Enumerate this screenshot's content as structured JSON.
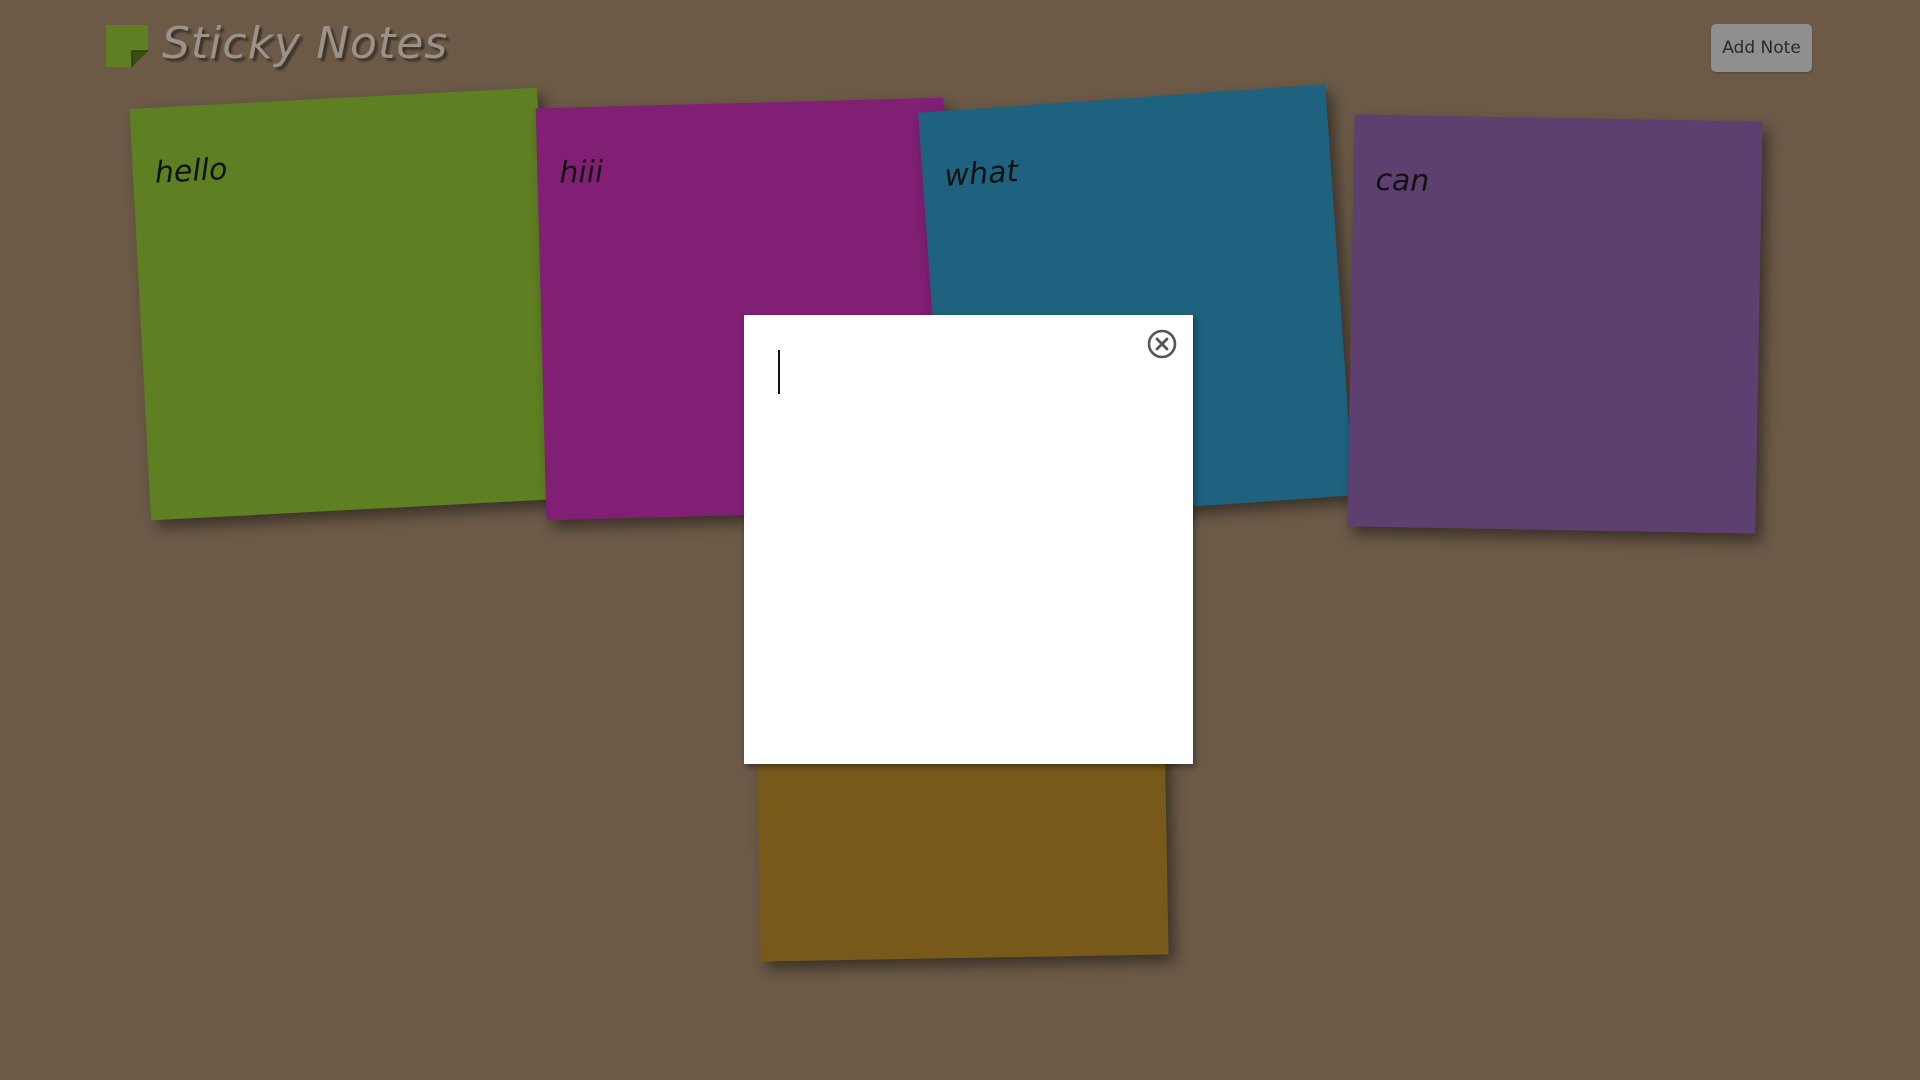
{
  "app": {
    "title": "Sticky Notes",
    "logo_icon": "sticky-note-icon",
    "logo_color": "#5e7f22"
  },
  "toolbar": {
    "add_note_label": "Add Note"
  },
  "notes": [
    {
      "text": "hello",
      "color": "#5e7f22"
    },
    {
      "text": "hiii",
      "color": "#801f74"
    },
    {
      "text": "what",
      "color": "#1f6280"
    },
    {
      "text": "can",
      "color": "#5d3f70"
    },
    {
      "text": "",
      "color": "#775a1a"
    }
  ],
  "editor": {
    "value": "",
    "close_icon": "close-circle-icon"
  },
  "colors": {
    "background": "#6c5a47",
    "button": "#8f8f8f"
  }
}
